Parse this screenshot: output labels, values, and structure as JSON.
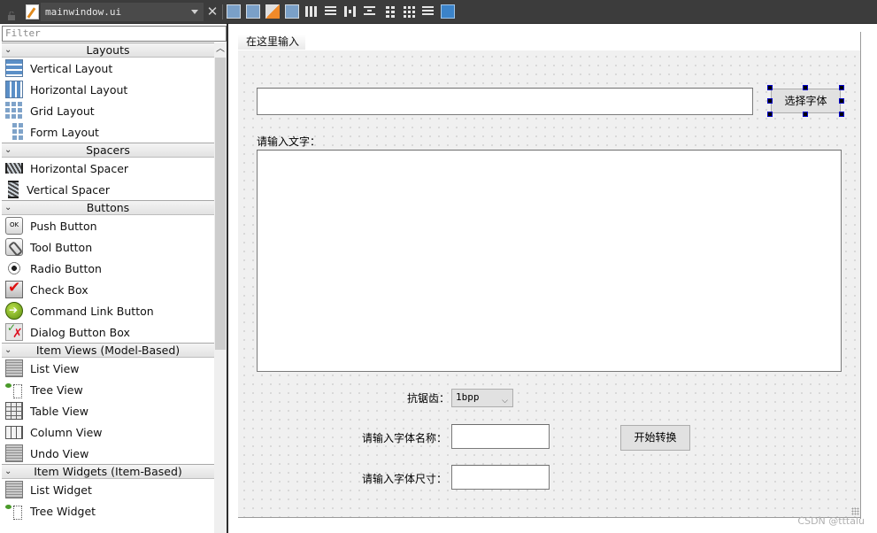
{
  "toolbar": {
    "file_name": "mainwindow.ui",
    "icons": [
      "edit-widgets-icon",
      "edit-signals-slots-icon",
      "edit-buddies-icon",
      "edit-tab-order-icon",
      "lay-out-horizontally-icon",
      "lay-out-vertically-icon",
      "lay-out-horizontal-splitter-icon",
      "lay-out-vertical-splitter-icon",
      "lay-out-form-icon",
      "lay-out-grid-icon",
      "break-layout-icon",
      "adjust-size-icon"
    ]
  },
  "widget_box": {
    "filter_placeholder": "Filter",
    "categories": [
      {
        "title": "Layouts",
        "items": [
          {
            "label": "Vertical Layout",
            "icon": "vertical-layout-icon"
          },
          {
            "label": "Horizontal Layout",
            "icon": "horizontal-layout-icon"
          },
          {
            "label": "Grid Layout",
            "icon": "grid-layout-icon"
          },
          {
            "label": "Form Layout",
            "icon": "form-layout-icon"
          }
        ]
      },
      {
        "title": "Spacers",
        "items": [
          {
            "label": "Horizontal Spacer",
            "icon": "horizontal-spacer-icon"
          },
          {
            "label": "Vertical Spacer",
            "icon": "vertical-spacer-icon"
          }
        ]
      },
      {
        "title": "Buttons",
        "items": [
          {
            "label": "Push Button",
            "icon": "push-button-icon"
          },
          {
            "label": "Tool Button",
            "icon": "tool-button-icon"
          },
          {
            "label": "Radio Button",
            "icon": "radio-button-icon"
          },
          {
            "label": "Check Box",
            "icon": "check-box-icon"
          },
          {
            "label": "Command Link Button",
            "icon": "command-link-icon"
          },
          {
            "label": "Dialog Button Box",
            "icon": "dialog-button-box-icon"
          }
        ]
      },
      {
        "title": "Item Views (Model-Based)",
        "items": [
          {
            "label": "List View",
            "icon": "list-view-icon"
          },
          {
            "label": "Tree View",
            "icon": "tree-view-icon"
          },
          {
            "label": "Table View",
            "icon": "table-view-icon"
          },
          {
            "label": "Column View",
            "icon": "column-view-icon"
          },
          {
            "label": "Undo View",
            "icon": "undo-view-icon"
          }
        ]
      },
      {
        "title": "Item Widgets (Item-Based)",
        "items": [
          {
            "label": "List Widget",
            "icon": "list-widget-icon"
          },
          {
            "label": "Tree Widget",
            "icon": "tree-widget-icon"
          }
        ]
      }
    ]
  },
  "form": {
    "tab_label": "在这里输入",
    "font_path_value": "",
    "choose_font_button": "选择字体",
    "text_label": "请输入文字：",
    "text_value": "",
    "antialias_label": "抗锯齿：",
    "antialias_selected": "1bpp",
    "font_name_label": "请输入字体名称：",
    "font_name_value": "",
    "font_size_label": "请输入字体尺寸：",
    "font_size_value": "",
    "convert_button": "开始转换"
  },
  "watermark": "CSDN @tttalu"
}
